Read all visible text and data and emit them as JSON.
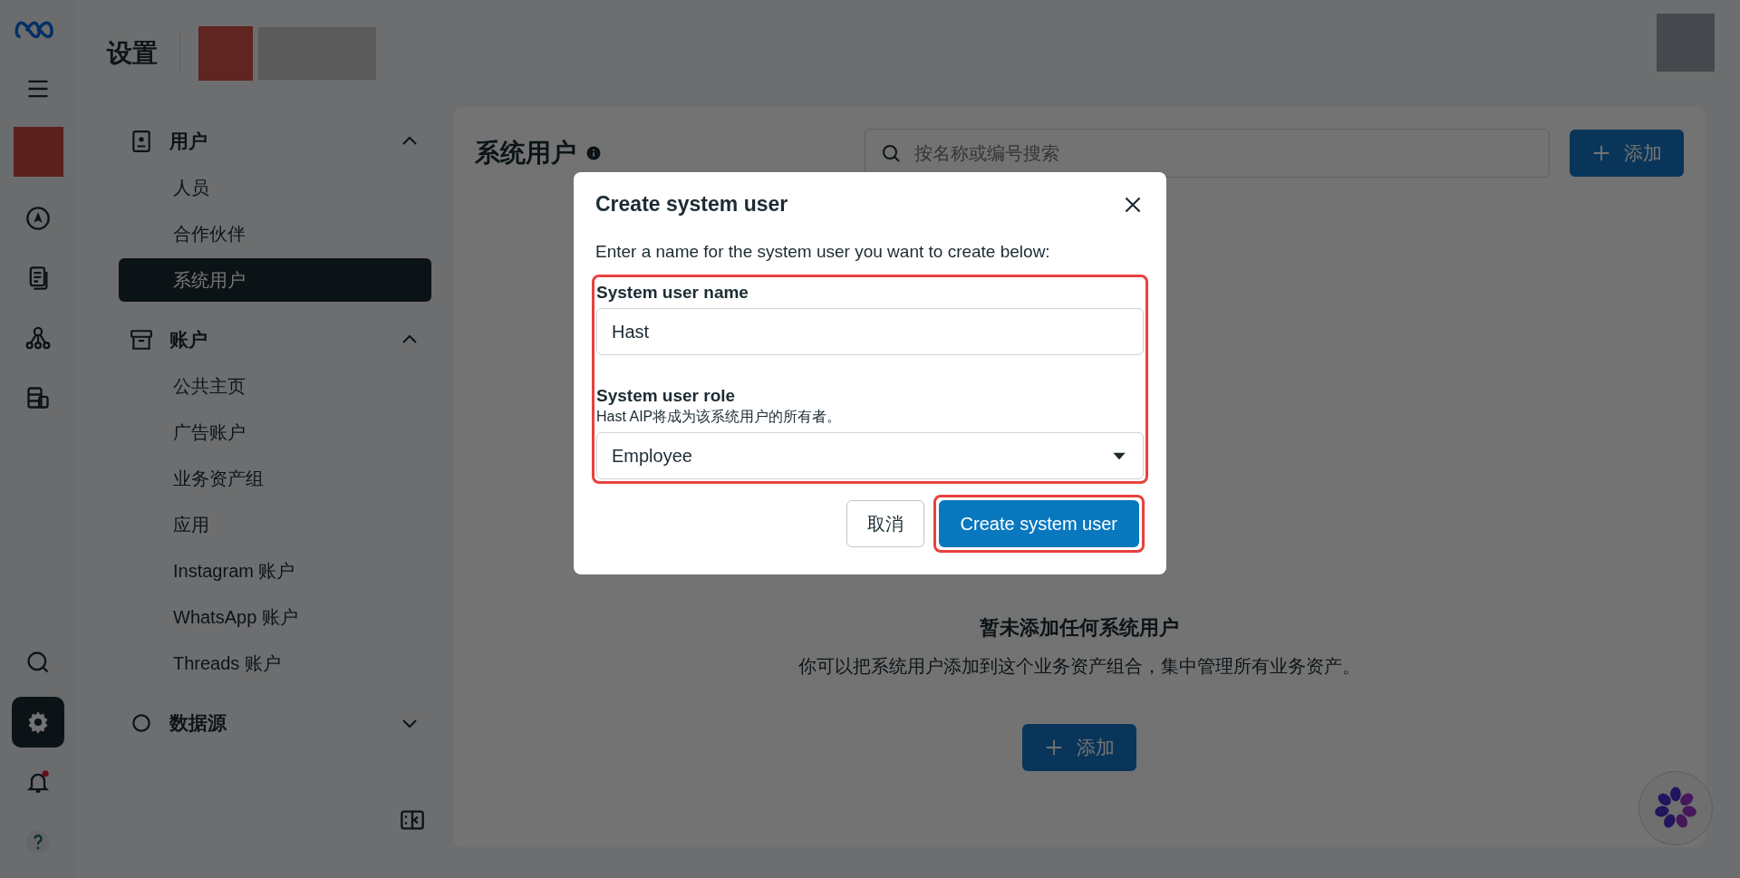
{
  "rail": {
    "items": [
      {
        "kind": "menu",
        "selected": false
      },
      {
        "kind": "avatar",
        "selected": false
      },
      {
        "kind": "compass",
        "selected": false
      },
      {
        "kind": "pages",
        "selected": false
      },
      {
        "kind": "network",
        "selected": false
      },
      {
        "kind": "database",
        "selected": false
      }
    ],
    "bottom_items": [
      {
        "kind": "search",
        "selected": false
      },
      {
        "kind": "settings",
        "selected": true
      },
      {
        "kind": "bell",
        "selected": false,
        "badge": true
      },
      {
        "kind": "help",
        "selected": false
      }
    ]
  },
  "header": {
    "title": "设置"
  },
  "sidebar": {
    "sections": [
      {
        "kind": "user",
        "label": "用户",
        "expanded": true,
        "items": [
          {
            "label": "人员",
            "selected": false
          },
          {
            "label": "合作伙伴",
            "selected": false
          },
          {
            "label": "系统用户",
            "selected": true
          }
        ]
      },
      {
        "kind": "account",
        "label": "账户",
        "expanded": true,
        "items": [
          {
            "label": "公共主页",
            "selected": false
          },
          {
            "label": "广告账户",
            "selected": false
          },
          {
            "label": "业务资产组",
            "selected": false
          },
          {
            "label": "应用",
            "selected": false
          },
          {
            "label": "Instagram 账户",
            "selected": false
          },
          {
            "label": "WhatsApp 账户",
            "selected": false
          },
          {
            "label": "Threads 账户",
            "selected": false
          }
        ]
      },
      {
        "kind": "data",
        "label": "数据源",
        "expanded": false
      }
    ]
  },
  "content": {
    "title": "系统用户",
    "search": {
      "placeholder": "按名称或编号搜索"
    },
    "add_button": "添加",
    "empty_title": "暂未添加任何系统用户",
    "empty_text": "你可以把系统用户添加到这个业务资产组合，集中管理所有业务资产。",
    "empty_button": "添加"
  },
  "dialog": {
    "title": "Create system user",
    "intro": "Enter a name for the system user you want to create below:",
    "fields_highlighted": true,
    "fields": [
      {
        "kind": "text",
        "label": "System user name",
        "value": "Hast"
      },
      {
        "kind": "select",
        "label": "System user role",
        "hint": "Hast AIP将成为该系统用户的所有者。",
        "value": "Employee"
      }
    ],
    "buttons": [
      {
        "kind": "secondary",
        "label": "取消",
        "highlighted": false
      },
      {
        "kind": "primary",
        "label": "Create system user",
        "highlighted": true
      }
    ]
  }
}
